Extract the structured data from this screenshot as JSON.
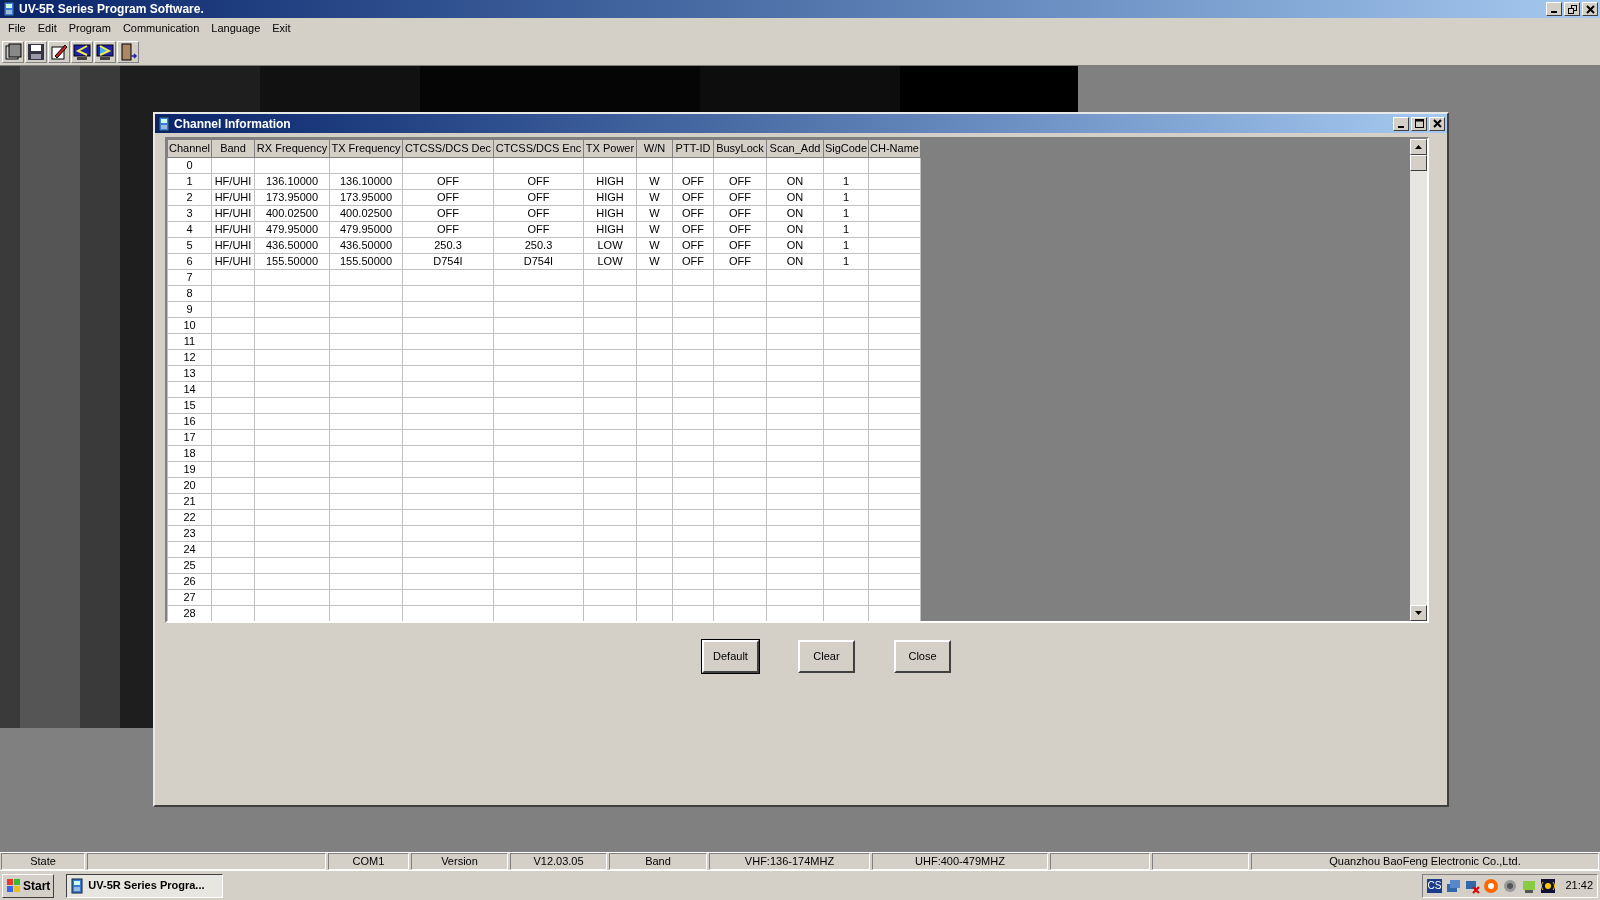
{
  "window": {
    "title": "UV-5R Series Program Software."
  },
  "menu": [
    "File",
    "Edit",
    "Program",
    "Communication",
    "Language",
    "Exit"
  ],
  "dialog": {
    "title": "Channel Information",
    "table": {
      "columns": [
        "Channel",
        "Band",
        "RX Frequency",
        "TX Frequency",
        "CTCSS/DCS Dec",
        "CTCSS/DCS Enc",
        "TX Power",
        "W/N",
        "PTT-ID",
        "BusyLock",
        "Scan_Add",
        "SigCode",
        "CH-Name"
      ],
      "rows": [
        [
          "0"
        ],
        [
          "1",
          "HF/UHI",
          "136.10000",
          "136.10000",
          "OFF",
          "OFF",
          "HIGH",
          "W",
          "OFF",
          "OFF",
          "ON",
          "1"
        ],
        [
          "2",
          "HF/UHI",
          "173.95000",
          "173.95000",
          "OFF",
          "OFF",
          "HIGH",
          "W",
          "OFF",
          "OFF",
          "ON",
          "1"
        ],
        [
          "3",
          "HF/UHI",
          "400.02500",
          "400.02500",
          "OFF",
          "OFF",
          "HIGH",
          "W",
          "OFF",
          "OFF",
          "ON",
          "1"
        ],
        [
          "4",
          "HF/UHI",
          "479.95000",
          "479.95000",
          "OFF",
          "OFF",
          "HIGH",
          "W",
          "OFF",
          "OFF",
          "ON",
          "1"
        ],
        [
          "5",
          "HF/UHI",
          "436.50000",
          "436.50000",
          "250.3",
          "250.3",
          "LOW",
          "W",
          "OFF",
          "OFF",
          "ON",
          "1"
        ],
        [
          "6",
          "HF/UHI",
          "155.50000",
          "155.50000",
          "D754I",
          "D754I",
          "LOW",
          "W",
          "OFF",
          "OFF",
          "ON",
          "1"
        ],
        [
          "7"
        ],
        [
          "8"
        ],
        [
          "9"
        ],
        [
          "10"
        ],
        [
          "11"
        ],
        [
          "12"
        ],
        [
          "13"
        ],
        [
          "14"
        ],
        [
          "15"
        ],
        [
          "16"
        ],
        [
          "17"
        ],
        [
          "18"
        ],
        [
          "19"
        ],
        [
          "20"
        ],
        [
          "21"
        ],
        [
          "22"
        ],
        [
          "23"
        ],
        [
          "24"
        ],
        [
          "25"
        ],
        [
          "26"
        ],
        [
          "27"
        ],
        [
          "28"
        ]
      ]
    },
    "buttons": [
      {
        "label": "Default",
        "focused": true
      },
      {
        "label": "Clear",
        "focused": false
      },
      {
        "label": "Close",
        "focused": false
      }
    ]
  },
  "status_bar": [
    {
      "kind": "text",
      "text": "State"
    },
    {
      "kind": "blank"
    },
    {
      "kind": "text",
      "text": "COM1"
    },
    {
      "kind": "text",
      "text": "Version"
    },
    {
      "kind": "text",
      "text": "V12.03.05"
    },
    {
      "kind": "text",
      "text": "Band"
    },
    {
      "kind": "text",
      "text": "VHF:136-174MHZ"
    },
    {
      "kind": "text",
      "text": "UHF:400-479MHZ"
    },
    {
      "kind": "blank"
    },
    {
      "kind": "blank"
    },
    {
      "kind": "text",
      "text": "Quanzhou BaoFeng Electronic Co.,Ltd."
    }
  ],
  "taskbar": {
    "start": "Start",
    "task": "UV-5R Series Progra...",
    "clock": "21:42",
    "tray_text": "CS"
  }
}
